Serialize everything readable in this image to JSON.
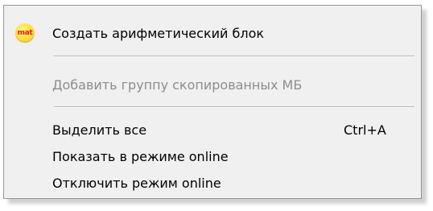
{
  "context_menu": {
    "items": [
      {
        "icon": "mat-icon",
        "icon_text": "mat",
        "label": "Создать арифметический блок",
        "enabled": true
      },
      {
        "label": "Добавить группу скопированных МБ",
        "enabled": false
      },
      {
        "label": "Выделить все",
        "shortcut": "Ctrl+A",
        "enabled": true
      },
      {
        "label": "Показать в режиме online",
        "enabled": true
      },
      {
        "label": "Отключить режим  online",
        "enabled": true
      }
    ]
  },
  "colors": {
    "menu_background": "#f0f0f0",
    "menu_border": "#979797",
    "disabled_text": "#8d8d8d",
    "separator": "#b5b5b5",
    "icon_fill": "#ffe14a",
    "icon_text": "#e21c1c"
  }
}
